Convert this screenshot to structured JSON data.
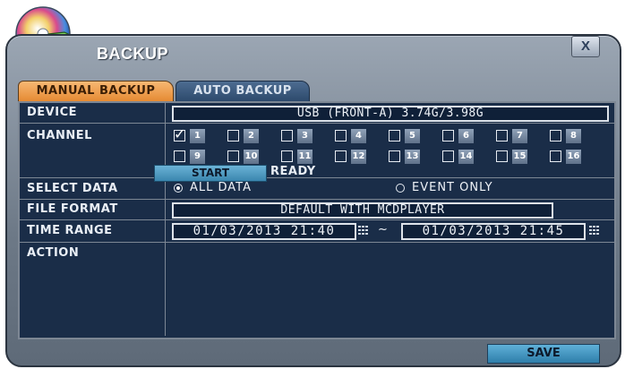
{
  "window": {
    "title": "BACKUP",
    "close_label": "X",
    "icon": "backup-disc-icon"
  },
  "tabs": [
    {
      "label": "MANUAL BACKUP",
      "active": true
    },
    {
      "label": "AUTO BACKUP",
      "active": false
    }
  ],
  "labels": {
    "device": "DEVICE",
    "channel": "CHANNEL",
    "select_data": "SELECT DATA",
    "file_format": "FILE FORMAT",
    "time_range": "TIME RANGE",
    "action": "ACTION"
  },
  "device_value": "USB (FRONT-A) 3.74G/3.98G",
  "channels": [
    {
      "num": "1",
      "checked": true
    },
    {
      "num": "2",
      "checked": false
    },
    {
      "num": "3",
      "checked": false
    },
    {
      "num": "4",
      "checked": false
    },
    {
      "num": "5",
      "checked": false
    },
    {
      "num": "6",
      "checked": false
    },
    {
      "num": "7",
      "checked": false
    },
    {
      "num": "8",
      "checked": false
    },
    {
      "num": "9",
      "checked": false
    },
    {
      "num": "10",
      "checked": false
    },
    {
      "num": "11",
      "checked": false
    },
    {
      "num": "12",
      "checked": false
    },
    {
      "num": "13",
      "checked": false
    },
    {
      "num": "14",
      "checked": false
    },
    {
      "num": "15",
      "checked": false
    },
    {
      "num": "16",
      "checked": false
    }
  ],
  "select_data": {
    "all_data_label": "ALL DATA",
    "event_only_label": "EVENT ONLY",
    "selected": "ALL DATA"
  },
  "file_format_value": "DEFAULT WITH MCDPLAYER",
  "time_range": {
    "start": "01/03/2013  21:40",
    "separator": "~",
    "end": "01/03/2013  21:45"
  },
  "action": {
    "start_label": "START",
    "status": "READY"
  },
  "save_label": "SAVE",
  "colors": {
    "panel_bg": "#1a2d48",
    "active_tab": "#e58a33",
    "inactive_tab": "#2d4a6c",
    "button": "#3a86ae"
  }
}
